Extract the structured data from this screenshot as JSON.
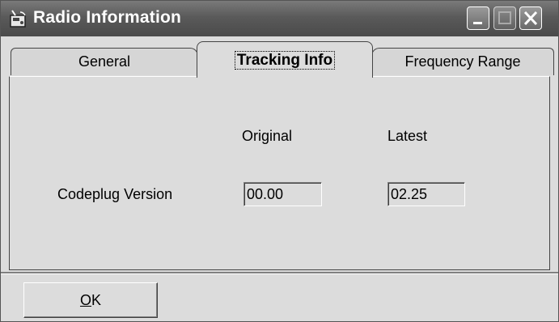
{
  "window": {
    "title": "Radio Information"
  },
  "title_buttons": {
    "minimize": "minimize-icon",
    "maximize": "maximize-icon",
    "close": "close-icon"
  },
  "tabs": [
    {
      "label": "General",
      "selected": false
    },
    {
      "label": "Tracking Info",
      "selected": true
    },
    {
      "label": "Frequency Range",
      "selected": false
    }
  ],
  "tracking": {
    "col_original": "Original",
    "col_latest": "Latest",
    "row_label": "Codeplug Version",
    "original_value": "00.00",
    "latest_value": "02.25"
  },
  "buttons": {
    "ok_mnemonic": "O",
    "ok_rest": "K"
  }
}
